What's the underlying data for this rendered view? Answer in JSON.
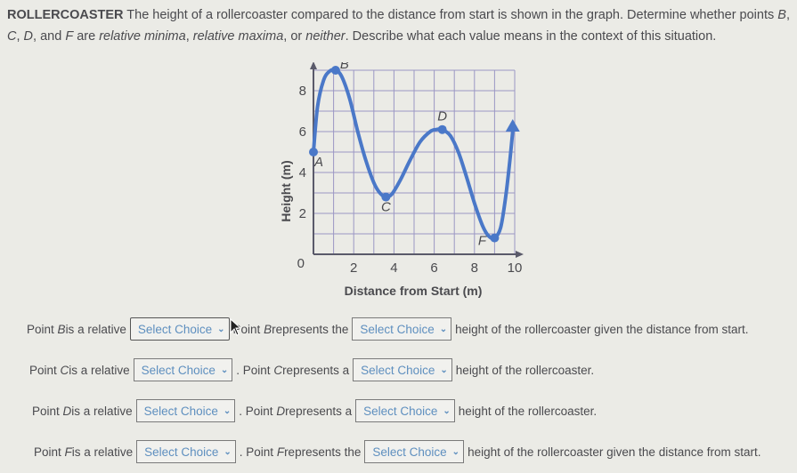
{
  "prompt": {
    "keyword": "ROLLERCOASTER",
    "text_1": " The height of a rollercoaster compared to the distance from start is shown in the graph. Determine whether points ",
    "pt_B": "B",
    "comma_1": ", ",
    "pt_C": "C",
    "comma_2": ", ",
    "pt_D": "D",
    "text_2": ", and ",
    "pt_F": "F",
    "text_3": " are ",
    "opt_min": "relative minima",
    "comma_3": ", ",
    "opt_max": "relative maxima",
    "text_4": ", or ",
    "opt_neither": "neither",
    "text_5": ". Describe what each value means in the context of this situation."
  },
  "chart_data": {
    "type": "line",
    "xlabel": "Distance from Start (m)",
    "ylabel": "Height (m)",
    "xlim": [
      0,
      10
    ],
    "ylim": [
      0,
      9
    ],
    "x_ticks": [
      2,
      4,
      6,
      8,
      10
    ],
    "y_ticks": [
      2,
      4,
      6,
      8
    ],
    "origin_label": "0",
    "grid": true,
    "grid_step": 1,
    "curve_color": "#4a78c8",
    "points": [
      {
        "label": "A",
        "x": 0,
        "y": 5
      },
      {
        "label": "B",
        "x": 1.1,
        "y": 9
      },
      {
        "label": "C",
        "x": 3.6,
        "y": 2.8
      },
      {
        "label": "D",
        "x": 6.4,
        "y": 6.1
      },
      {
        "label": "F",
        "x": 9.0,
        "y": 0.8
      }
    ],
    "curve": [
      [
        0,
        5
      ],
      [
        0.2,
        7.2
      ],
      [
        0.5,
        8.5
      ],
      [
        0.8,
        8.95
      ],
      [
        1.1,
        9.0
      ],
      [
        1.4,
        8.7
      ],
      [
        1.8,
        7.6
      ],
      [
        2.2,
        6.0
      ],
      [
        2.6,
        4.6
      ],
      [
        3.0,
        3.5
      ],
      [
        3.3,
        3.0
      ],
      [
        3.6,
        2.8
      ],
      [
        3.9,
        2.95
      ],
      [
        4.3,
        3.6
      ],
      [
        4.8,
        4.6
      ],
      [
        5.3,
        5.5
      ],
      [
        5.8,
        6.0
      ],
      [
        6.1,
        6.1
      ],
      [
        6.4,
        6.1
      ],
      [
        6.8,
        5.8
      ],
      [
        7.2,
        5.0
      ],
      [
        7.6,
        3.8
      ],
      [
        8.0,
        2.5
      ],
      [
        8.4,
        1.4
      ],
      [
        8.7,
        0.9
      ],
      [
        9.0,
        0.8
      ],
      [
        9.3,
        1.3
      ],
      [
        9.55,
        2.8
      ],
      [
        9.75,
        4.5
      ],
      [
        9.9,
        6.0
      ]
    ],
    "end_arrow": "up"
  },
  "questions": [
    {
      "point": "B",
      "part1": "Point ",
      "part2": " is a relative",
      "select1": "Select Choice",
      "sep": " Point ",
      "part3": " represents the",
      "select2": "Select Choice",
      "tail": "height of the rollercoaster given the distance from start."
    },
    {
      "point": "C",
      "part1": "Point ",
      "part2": " is a relative",
      "select1": "Select Choice",
      "sep": ". Point ",
      "part3": " represents a",
      "select2": "Select Choice",
      "tail": "height of the rollercoaster."
    },
    {
      "point": "D",
      "part1": "Point ",
      "part2": " is a relative",
      "select1": "Select Choice",
      "sep": ". Point ",
      "part3": " represents a",
      "select2": "Select Choice",
      "tail": "height of the rollercoaster."
    },
    {
      "point": "F",
      "part1": "Point ",
      "part2": " is a relative",
      "select1": "Select Choice",
      "sep": ". Point ",
      "part3": " represents the",
      "select2": "Select Choice",
      "tail": "height of the rollercoaster given the distance from start."
    }
  ],
  "icons": {
    "chevron": "⌄"
  }
}
